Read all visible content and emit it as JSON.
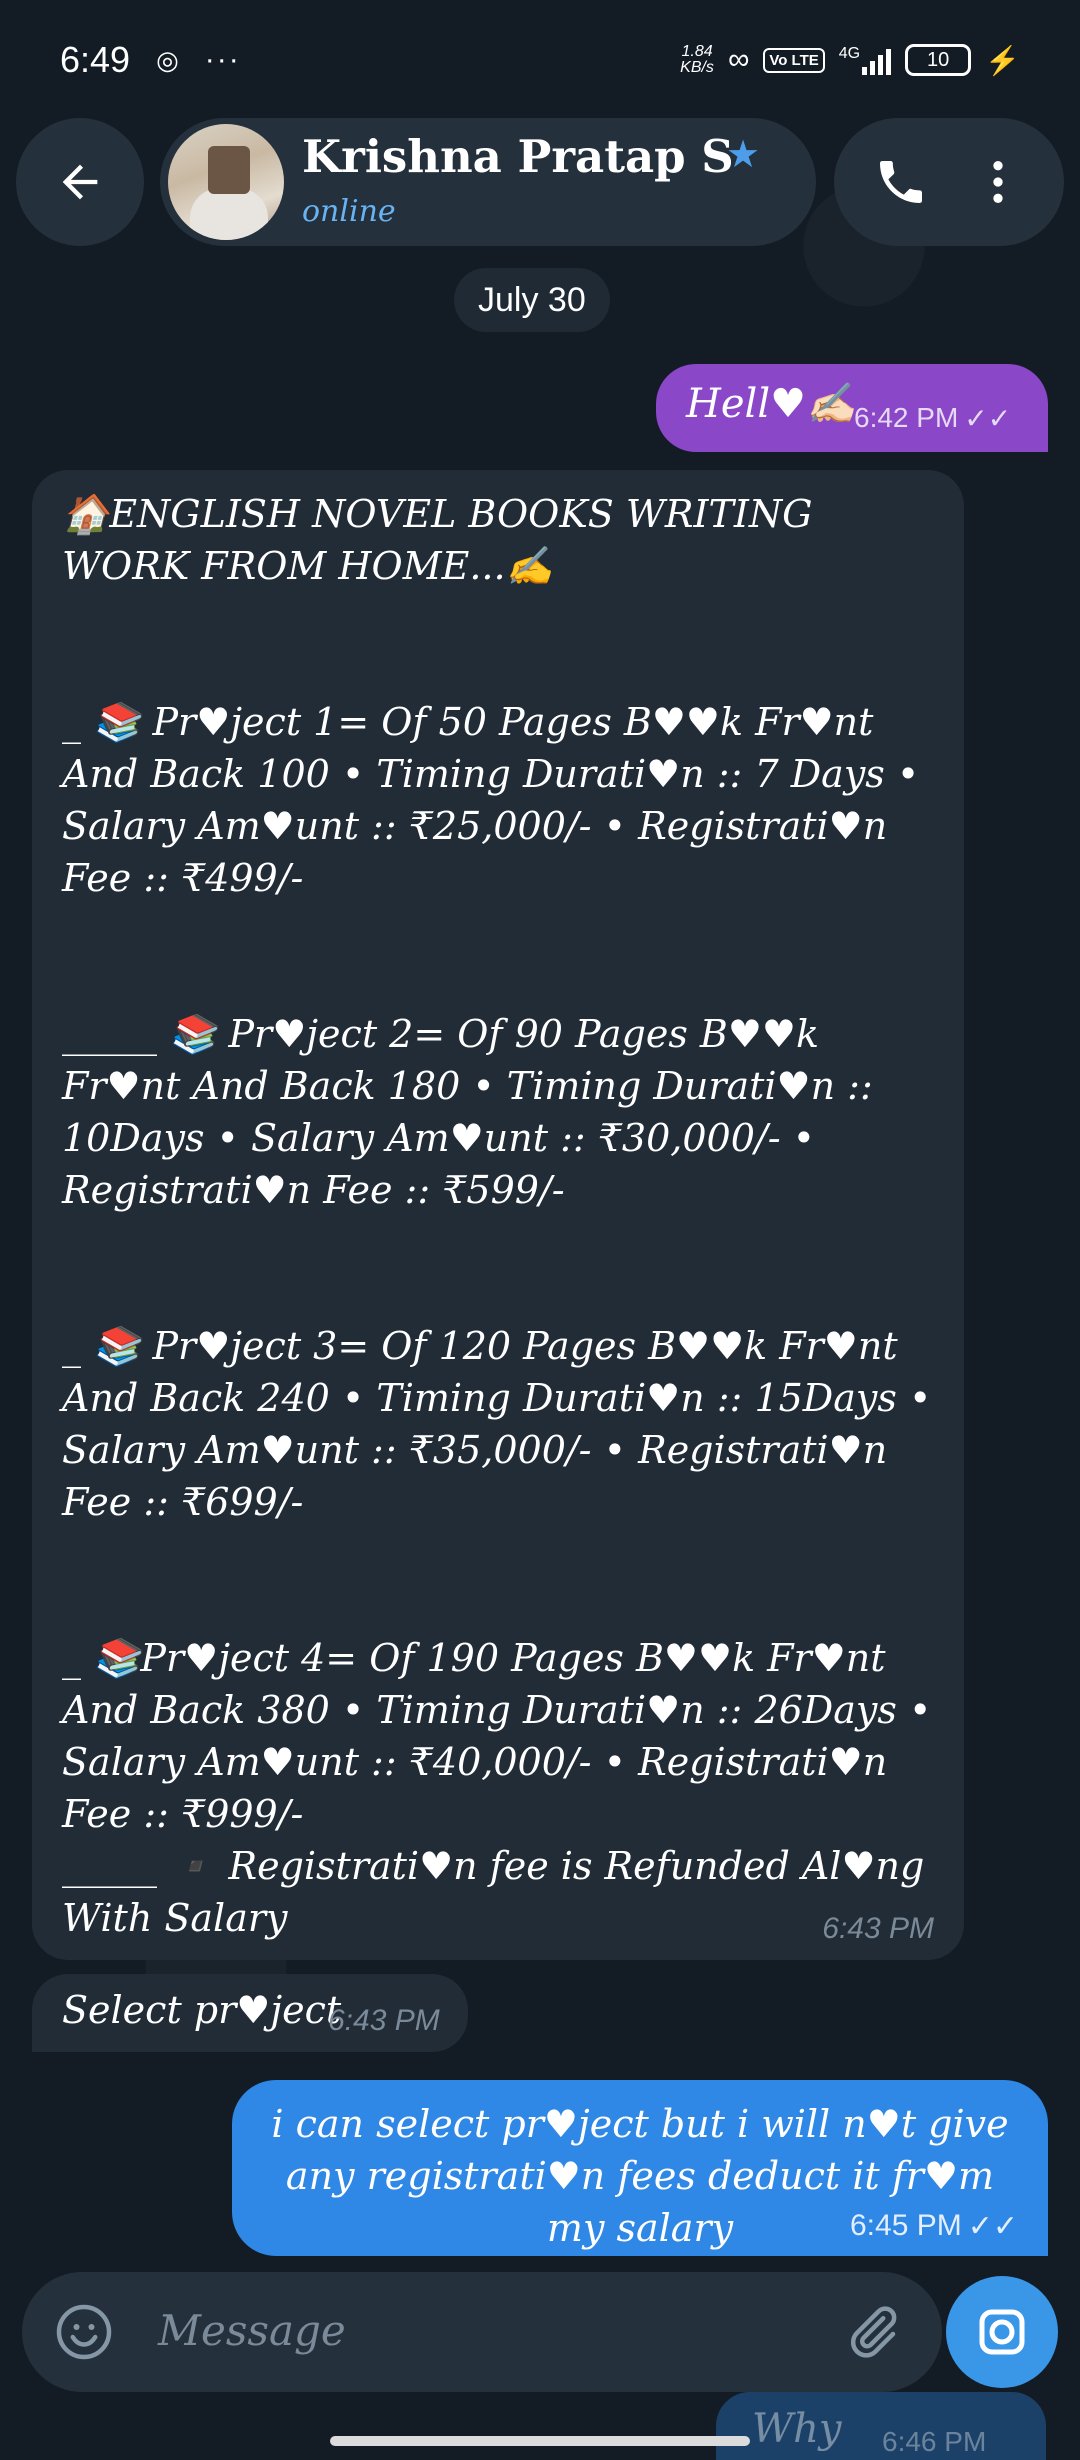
{
  "status_bar": {
    "time": "6:49",
    "speed_value": "1.84",
    "speed_unit": "KB/s",
    "volte": "Vo LTE",
    "network": "4G",
    "battery": "10"
  },
  "header": {
    "contact_name": "Krishna Pratap Sin",
    "status": "online"
  },
  "chat": {
    "date_chip": "July 30",
    "messages": [
      {
        "text": "Hell♥✍🏻",
        "time": "6:42 PM"
      },
      {
        "text": "🏠ENGLISH NOVEL BOOKS WRITING WORK FROM HOME...✍️\n\n\n_ 📚 Pr♥ject 1= Of 50 Pages B♥♥k Fr♥nt And Back 100 • Timing Durati♥n :: 7 Days • Salary Am♥unt :: ₹25,000/- • Registrati♥n Fee :: ₹499/-\n\n\n_____ 📚 Pr♥ject 2= Of 90 Pages B♥♥k Fr♥nt And Back 180 • Timing Durati♥n :: 10Days • Salary Am♥unt :: ₹30,000/- • Registrati♥n Fee :: ₹599/-\n\n\n_ 📚 Pr♥ject 3= Of 120 Pages B♥♥k Fr♥nt And Back 240 • Timing Durati♥n :: 15Days • Salary Am♥unt :: ₹35,000/- • Registrati♥n Fee :: ₹699/-\n\n\n_ 📚Pr♥ject 4= Of 190 Pages B♥♥k Fr♥nt And Back 380 • Timing Durati♥n :: 26Days • Salary Am♥unt :: ₹40,000/- • Registrati♥n Fee :: ₹999/-\n_____ ▪️ Registrati♥n fee is Refunded Al♥ng With Salary",
        "time": "6:43 PM"
      },
      {
        "text": "Select pr♥ject",
        "time": "6:43 PM"
      },
      {
        "text": "i can select pr♥ject but i will n♥t give any registrati♥n fees deduct it fr♥m my salary",
        "time": "6:45 PM"
      },
      {
        "text": "Why",
        "time": "6:46 PM"
      }
    ]
  },
  "composer": {
    "placeholder": "Message"
  },
  "colors": {
    "background": "#131c25",
    "incoming_bubble": "#212c37",
    "outgoing_purple": "#8a47c8",
    "outgoing_blue": "#2f87e6",
    "accent": "#6ab3f3"
  }
}
